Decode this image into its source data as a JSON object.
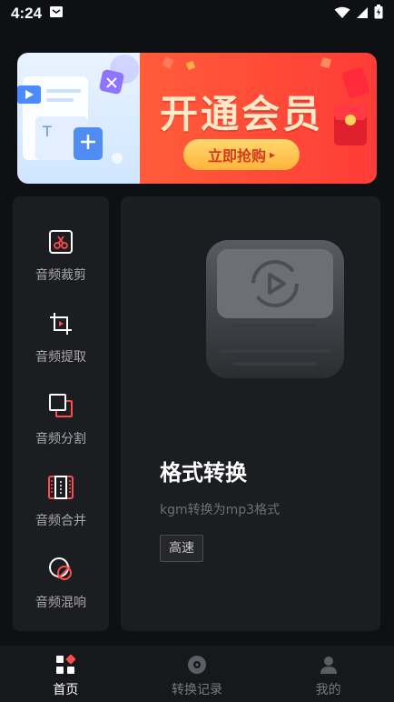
{
  "status_bar": {
    "time": "4:24"
  },
  "banner": {
    "title": "开通会员",
    "cta": "立即抢购",
    "cta_arrow": "▸",
    "colors": {
      "left_bg": "#dbeeff",
      "right_bg": "#ff4a38",
      "title": "#ffe9c9",
      "cta_bg": "#ffc24a",
      "cta_text": "#d23a1f"
    }
  },
  "tools": [
    {
      "label": "音频裁剪",
      "icon": "scissors-icon"
    },
    {
      "label": "音频提取",
      "icon": "crop-icon"
    },
    {
      "label": "音频分割",
      "icon": "split-icon"
    },
    {
      "label": "音频合并",
      "icon": "merge-icon"
    },
    {
      "label": "音频混响",
      "icon": "reverb-icon"
    }
  ],
  "feature": {
    "title": "格式转换",
    "description": "kgm转换为mp3格式",
    "tag": "高速",
    "icon": "convert-icon"
  },
  "bottom_nav": [
    {
      "label": "首页",
      "icon": "home-grid-icon",
      "active": true
    },
    {
      "label": "转换记录",
      "icon": "record-disc-icon",
      "active": false
    },
    {
      "label": "我的",
      "icon": "profile-icon",
      "active": false
    }
  ],
  "colors": {
    "background": "#0f1013",
    "card": "#1c1d21",
    "accent": "#ff4b4b"
  }
}
